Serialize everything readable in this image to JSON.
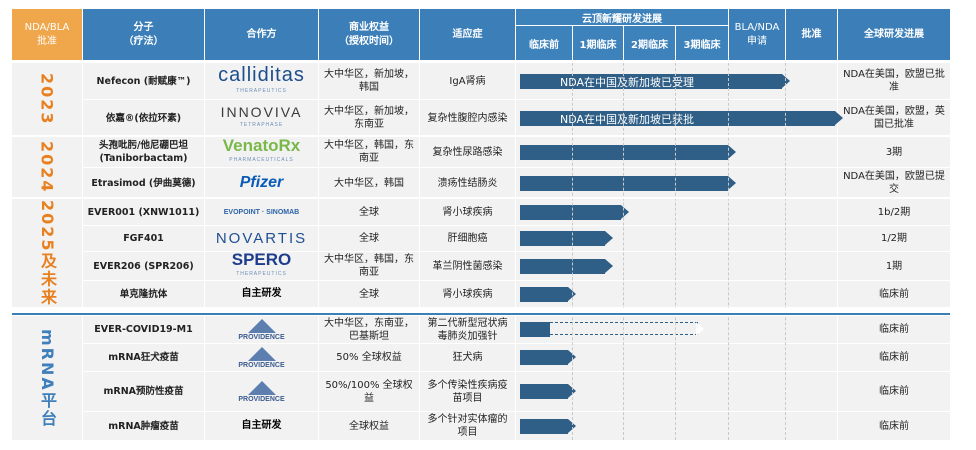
{
  "header": {
    "nda_bla": "NDA/BLA\n批准",
    "molecule": "分子\n（疗法）",
    "partner": "合作方",
    "rights": "商业权益\n（授权时间）",
    "indication": "适应症",
    "stage_group": "云顶新耀研发进展",
    "preclinical": "临床前",
    "phase1": "1期临床",
    "phase2": "2期临床",
    "phase3": "3期临床",
    "bla_filing": "BLA/NDA\n申请",
    "approval": "批准",
    "global": "全球研发进展"
  },
  "groups": [
    {
      "label": "2023"
    },
    {
      "label": "2024"
    },
    {
      "label": "2025及未来"
    },
    {
      "label": "mRNA平台"
    }
  ],
  "rows": [
    {
      "molecule": "Nefecon (耐赋康™)",
      "partner_logo": "calliditas",
      "partner_sub": "THERAPEUTICS",
      "rights": "大中华区，新加坡，韩国",
      "indication": "IgA肾病",
      "bar_label": "NDA在中国及新加坡已受理",
      "global": "NDA在美国，欧盟已批准",
      "progress": 5
    },
    {
      "molecule": "依嘉®(依拉环素)",
      "partner_logo": "INNOVIVA",
      "partner_sub": "TETRAPHASE",
      "rights": "大中华区，新加坡，东南亚",
      "indication": "复杂性腹腔内感染",
      "bar_label": "NDA在中国及新加坡已获批",
      "global": "NDA在美国，欧盟，英国已批准",
      "progress": 6
    },
    {
      "molecule": "头孢吡肟/他尼硼巴坦 (Taniborbactam)",
      "partner_logo": "VenatoRx",
      "partner_sub": "PHARMACEUTICALS",
      "rights": "大中华区，韩国，东南亚",
      "indication": "复杂性尿路感染",
      "bar_label": "",
      "global": "3期",
      "progress": 4
    },
    {
      "molecule": "Etrasimod (伊曲莫德)",
      "partner_logo": "Pfizer",
      "partner_sub": "",
      "rights": "大中华区，韩国",
      "indication": "溃疡性结肠炎",
      "bar_label": "",
      "global": "NDA在美国，欧盟已提交",
      "progress": 4
    },
    {
      "molecule": "EVER001 (XNW1011)",
      "partner_logo": "EVOPOINT · SINOMAB",
      "partner_sub": "",
      "rights": "全球",
      "indication": "肾小球疾病",
      "bar_label": "",
      "global": "1b/2期",
      "progress": 2
    },
    {
      "molecule": "FGF401",
      "partner_logo": "NOVARTIS",
      "partner_sub": "",
      "rights": "全球",
      "indication": "肝细胞癌",
      "bar_label": "",
      "global": "1/2期",
      "progress": 1.7
    },
    {
      "molecule": "EVER206 (SPR206)",
      "partner_logo": "SPERO",
      "partner_sub": "THERAPEUTICS",
      "rights": "大中华区，韩国，东南亚",
      "indication": "革兰阴性菌感染",
      "bar_label": "",
      "global": "1期",
      "progress": 1.7
    },
    {
      "molecule": "单克隆抗体",
      "partner_logo": "自主研发",
      "partner_sub": "",
      "rights": "全球",
      "indication": "肾小球疾病",
      "bar_label": "",
      "global": "临床前",
      "progress": 1
    },
    {
      "molecule": "EVER-COVID19-M1",
      "partner_logo": "PROVIDENCE",
      "partner_sub": "THERAPEUTICS",
      "rights": "大中华区，东南亚，巴基斯坦",
      "indication": "第二代新型冠状病毒肺炎加强针",
      "bar_label": "",
      "global": "临床前",
      "progress": 1
    },
    {
      "molecule": "mRNA狂犬疫苗",
      "partner_logo": "PROVIDENCE",
      "partner_sub": "THERAPEUTICS",
      "rights": "50% 全球权益",
      "indication": "狂犬病",
      "bar_label": "",
      "global": "临床前",
      "progress": 1
    },
    {
      "molecule": "mRNA预防性疫苗",
      "partner_logo": "PROVIDENCE",
      "partner_sub": "THERAPEUTICS",
      "rights": "50%/100% 全球权益",
      "indication": "多个传染性疾病疫苗项目",
      "bar_label": "",
      "global": "临床前",
      "progress": 1
    },
    {
      "molecule": "mRNA肿瘤疫苗",
      "partner_logo": "自主研发",
      "partner_sub": "",
      "rights": "全球权益",
      "indication": "多个针对实体瘤的项目",
      "bar_label": "",
      "global": "临床前",
      "progress": 1
    }
  ],
  "colors": {
    "header_blue": "#3c7fb8",
    "orange": "#f0a64a",
    "bar_navy": "#2f5f86",
    "year_orange": "#e8801f"
  }
}
